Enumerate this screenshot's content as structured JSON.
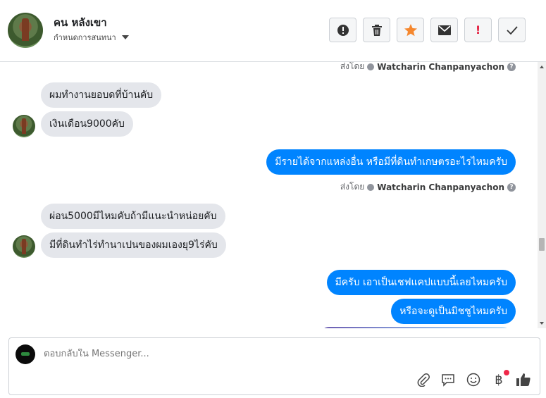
{
  "header": {
    "contact_name": "คน หลังเขา",
    "conversation_settings": "กำหนดการสนทนา"
  },
  "toolbar": {
    "spam_icon": "!",
    "important_icon": "!"
  },
  "thread": {
    "sender_name": "Watcharin Chanpanyachon",
    "sent_by_label": "ส่งโดย",
    "messages": [
      {
        "text": "ผมทำงานยอบดที่บ้านคับ"
      },
      {
        "text": "เงินเดือน9000คับ"
      },
      {
        "text": "มีรายได้จากแหล่งอื่น หรือมีที่ดินทำเกษตรอะไรไหมครับ"
      },
      {
        "text": "ผ่อน5000มีไหมคับถ้ามีแนะนำหน่อยคับ"
      },
      {
        "text": "มีที่ดินทำไร่ทำนาเปนของผมเองยุ9ไร่คับ"
      },
      {
        "text": "มีครับ เอาเป็นเชฟแคปแบบนี้เลยไหมครับ"
      },
      {
        "text": "หรือจะดูเป็นมิชชูไหมครับ"
      }
    ]
  },
  "composer": {
    "placeholder": "ตอบกลับใน Messenger...",
    "currency_symbol": "฿"
  },
  "colors": {
    "outgoing_bubble": "#0084ff",
    "incoming_bubble": "#e4e6eb",
    "star_icon": "#f5872e",
    "important_icon": "#e41e3f",
    "notification_dot": "#f02849"
  }
}
